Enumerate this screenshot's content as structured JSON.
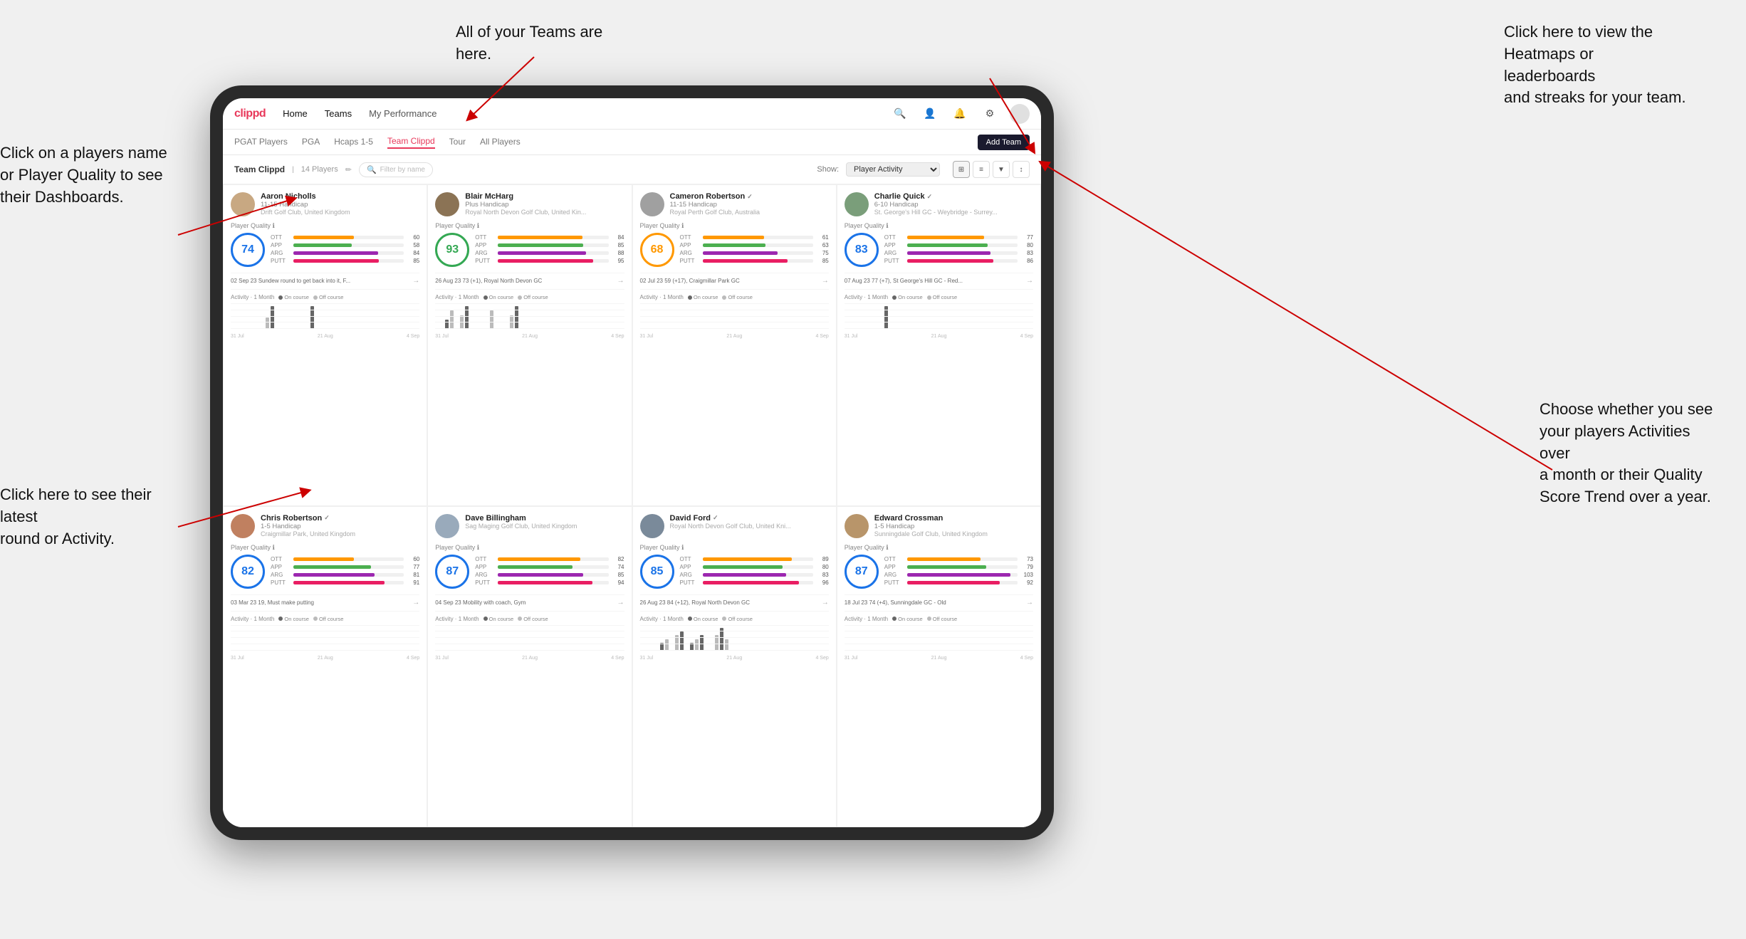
{
  "annotations": {
    "teams_tooltip": "All of your Teams are here.",
    "heatmaps_tooltip": "Click here to view the\nHeatmaps or leaderboards\nand streaks for your team.",
    "players_name_tooltip": "Click on a players name\nor Player Quality to see\ntheir Dashboards.",
    "activity_tooltip": "Choose whether you see\nyour players Activities over\na month or their Quality\nScore Trend over a year.",
    "latest_round_tooltip": "Click here to see their latest\nround or Activity."
  },
  "nav": {
    "logo": "clippd",
    "links": [
      "Home",
      "Teams",
      "My Performance"
    ],
    "add_team_label": "Add Team"
  },
  "sub_nav": {
    "links": [
      "PGAT Players",
      "PGA",
      "Hcaps 1-5",
      "Team Clippd",
      "Tour",
      "All Players"
    ]
  },
  "team_header": {
    "title": "Team Clippd",
    "count": "14 Players",
    "search_placeholder": "Filter by name",
    "show_label": "Show:",
    "show_value": "Player Activity"
  },
  "players": [
    {
      "name": "Aaron Nicholls",
      "handicap": "11-15 Handicap",
      "club": "Drift Golf Club, United Kingdom",
      "score": 74,
      "score_color": "blue",
      "stats": {
        "OTT": {
          "value": 60,
          "color": "#ff9800"
        },
        "APP": {
          "value": 58,
          "color": "#4caf50"
        },
        "ARG": {
          "value": 84,
          "color": "#9c27b0"
        },
        "PUTT": {
          "value": 85,
          "color": "#e91e63"
        }
      },
      "latest": "02 Sep 23  Sundew round to get back into it, F...",
      "chart_data": [
        0,
        0,
        0,
        0,
        0,
        0,
        0,
        1,
        2,
        0,
        0,
        0,
        0,
        0,
        0,
        0,
        2,
        0
      ],
      "x_labels": [
        "31 Jul",
        "21 Aug",
        "4 Sep"
      ]
    },
    {
      "name": "Blair McHarg",
      "handicap": "Plus Handicap",
      "club": "Royal North Devon Golf Club, United Kin...",
      "score": 93,
      "score_color": "green",
      "stats": {
        "OTT": {
          "value": 84,
          "color": "#ff9800"
        },
        "APP": {
          "value": 85,
          "color": "#4caf50"
        },
        "ARG": {
          "value": 88,
          "color": "#9c27b0"
        },
        "PUTT": {
          "value": 95,
          "color": "#e91e63"
        }
      },
      "latest": "26 Aug 23  73 (+1), Royal North Devon GC",
      "chart_data": [
        0,
        0,
        2,
        4,
        0,
        3,
        5,
        0,
        0,
        0,
        0,
        4,
        0,
        0,
        0,
        3,
        5,
        0
      ],
      "x_labels": [
        "31 Jul",
        "21 Aug",
        "4 Sep"
      ]
    },
    {
      "name": "Cameron Robertson",
      "verified": true,
      "handicap": "11-15 Handicap",
      "club": "Royal Perth Golf Club, Australia",
      "score": 68,
      "score_color": "orange",
      "stats": {
        "OTT": {
          "value": 61,
          "color": "#ff9800"
        },
        "APP": {
          "value": 63,
          "color": "#4caf50"
        },
        "ARG": {
          "value": 75,
          "color": "#9c27b0"
        },
        "PUTT": {
          "value": 85,
          "color": "#e91e63"
        }
      },
      "latest": "02 Jul 23  59 (+17), Craigmillar Park GC",
      "chart_data": [
        0,
        0,
        0,
        0,
        0,
        0,
        0,
        0,
        0,
        0,
        0,
        0,
        0,
        0,
        0,
        0,
        0,
        0
      ],
      "x_labels": [
        "31 Jul",
        "21 Aug",
        "4 Sep"
      ]
    },
    {
      "name": "Charlie Quick",
      "verified": true,
      "handicap": "6-10 Handicap",
      "club": "St. George's Hill GC - Weybridge - Surrey...",
      "score": 83,
      "score_color": "blue",
      "stats": {
        "OTT": {
          "value": 77,
          "color": "#ff9800"
        },
        "APP": {
          "value": 80,
          "color": "#4caf50"
        },
        "ARG": {
          "value": 83,
          "color": "#9c27b0"
        },
        "PUTT": {
          "value": 86,
          "color": "#e91e63"
        }
      },
      "latest": "07 Aug 23  77 (+7), St George's Hill GC - Red...",
      "chart_data": [
        0,
        0,
        0,
        0,
        0,
        0,
        0,
        0,
        2,
        0,
        0,
        0,
        0,
        0,
        0,
        0,
        0,
        0
      ],
      "x_labels": [
        "31 Jul",
        "21 Aug",
        "4 Sep"
      ]
    },
    {
      "name": "Chris Robertson",
      "verified": true,
      "handicap": "1-5 Handicap",
      "club": "Craigmillar Park, United Kingdom",
      "score": 82,
      "score_color": "blue",
      "stats": {
        "OTT": {
          "value": 60,
          "color": "#ff9800"
        },
        "APP": {
          "value": 77,
          "color": "#4caf50"
        },
        "ARG": {
          "value": 81,
          "color": "#9c27b0"
        },
        "PUTT": {
          "value": 91,
          "color": "#e91e63"
        }
      },
      "latest": "03 Mar 23  19, Must make putting",
      "chart_data": [
        0,
        0,
        0,
        0,
        0,
        0,
        0,
        0,
        0,
        0,
        0,
        0,
        0,
        0,
        0,
        0,
        0,
        0
      ],
      "x_labels": [
        "31 Jul",
        "21 Aug",
        "4 Sep"
      ]
    },
    {
      "name": "Dave Billingham",
      "handicap": "",
      "club": "Sag Maging Golf Club, United Kingdom",
      "score": 87,
      "score_color": "blue",
      "stats": {
        "OTT": {
          "value": 82,
          "color": "#ff9800"
        },
        "APP": {
          "value": 74,
          "color": "#4caf50"
        },
        "ARG": {
          "value": 85,
          "color": "#9c27b0"
        },
        "PUTT": {
          "value": 94,
          "color": "#e91e63"
        }
      },
      "latest": "04 Sep 23  Mobility with coach, Gym",
      "chart_data": [
        0,
        0,
        0,
        0,
        0,
        0,
        0,
        0,
        0,
        0,
        0,
        0,
        0,
        0,
        0,
        0,
        0,
        0
      ],
      "x_labels": [
        "31 Jul",
        "21 Aug",
        "4 Sep"
      ]
    },
    {
      "name": "David Ford",
      "verified": true,
      "handicap": "",
      "club": "Royal North Devon Golf Club, United Kni...",
      "score": 85,
      "score_color": "blue",
      "stats": {
        "OTT": {
          "value": 89,
          "color": "#ff9800"
        },
        "APP": {
          "value": 80,
          "color": "#4caf50"
        },
        "ARG": {
          "value": 83,
          "color": "#9c27b0"
        },
        "PUTT": {
          "value": 96,
          "color": "#e91e63"
        }
      },
      "latest": "26 Aug 23  84 (+12), Royal North Devon GC",
      "chart_data": [
        0,
        0,
        0,
        0,
        2,
        3,
        0,
        4,
        5,
        0,
        2,
        3,
        4,
        0,
        0,
        4,
        6,
        3
      ],
      "x_labels": [
        "31 Jul",
        "21 Aug",
        "4 Sep"
      ]
    },
    {
      "name": "Edward Crossman",
      "handicap": "1-5 Handicap",
      "club": "Sunningdale Golf Club, United Kingdom",
      "score": 87,
      "score_color": "blue",
      "stats": {
        "OTT": {
          "value": 73,
          "color": "#ff9800"
        },
        "APP": {
          "value": 79,
          "color": "#4caf50"
        },
        "ARG": {
          "value": 103,
          "color": "#9c27b0"
        },
        "PUTT": {
          "value": 92,
          "color": "#e91e63"
        }
      },
      "latest": "18 Jul 23  74 (+4), Sunningdale GC - Old",
      "chart_data": [
        0,
        0,
        0,
        0,
        0,
        0,
        0,
        0,
        0,
        0,
        0,
        0,
        0,
        0,
        0,
        0,
        0,
        0
      ],
      "x_labels": [
        "31 Jul",
        "21 Aug",
        "4 Sep"
      ]
    }
  ]
}
